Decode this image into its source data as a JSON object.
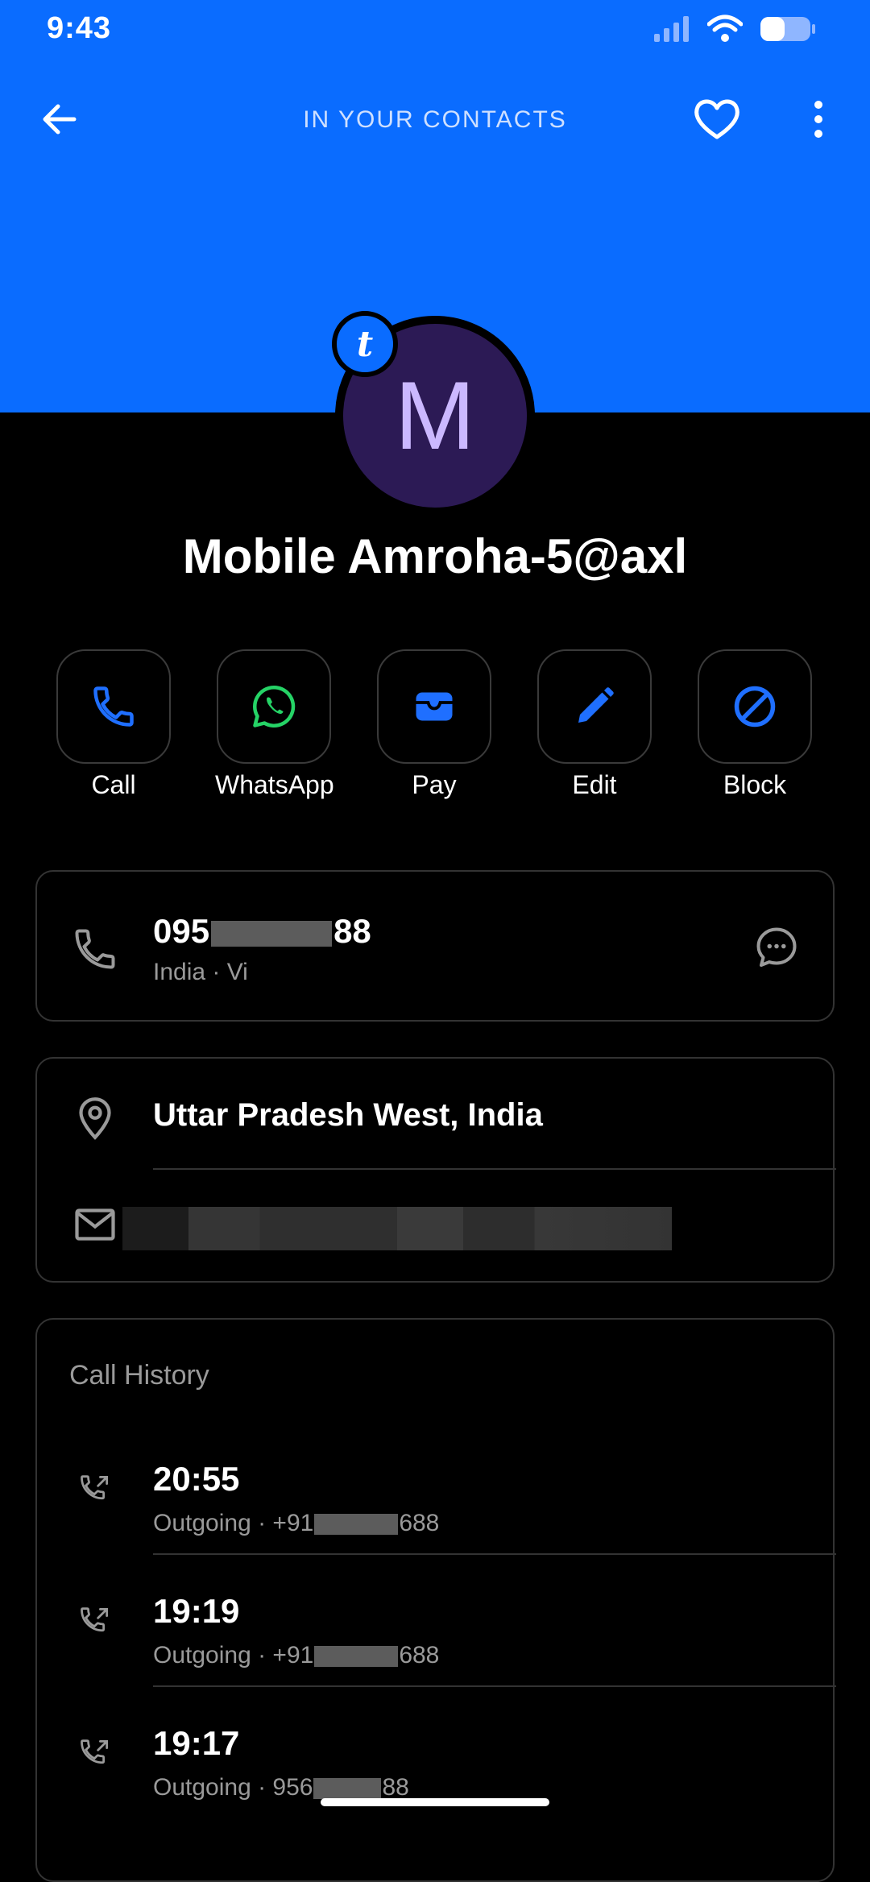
{
  "status": {
    "time": "9:43"
  },
  "topbar": {
    "title": "IN YOUR CONTACTS"
  },
  "avatar": {
    "initial": "M",
    "badge": "t"
  },
  "contact": {
    "name": "Mobile Amroha-5@axl"
  },
  "actions": [
    {
      "label": "Call",
      "icon": "phone-icon",
      "color": "#1f6fff"
    },
    {
      "label": "WhatsApp",
      "icon": "whatsapp-icon",
      "color": "#25d366"
    },
    {
      "label": "Pay",
      "icon": "wallet-icon",
      "color": "#1f6fff"
    },
    {
      "label": "Edit",
      "icon": "pencil-icon",
      "color": "#1f6fff"
    },
    {
      "label": "Block",
      "icon": "block-icon",
      "color": "#1f6fff"
    }
  ],
  "phone": {
    "number_start": "095",
    "number_end": "88",
    "detail": "India · Vi"
  },
  "location": {
    "text": "Uttar Pradesh West, India"
  },
  "history": {
    "title": "Call History",
    "items": [
      {
        "time": "20:55",
        "type": "Outgoing · +91",
        "number_end": "688"
      },
      {
        "time": "19:19",
        "type": "Outgoing · +91",
        "number_end": "688"
      },
      {
        "time": "19:17",
        "type": "Outgoing · 956",
        "number_end": "88"
      }
    ]
  },
  "colors": {
    "accent": "#0a6cff",
    "background": "#000000"
  }
}
